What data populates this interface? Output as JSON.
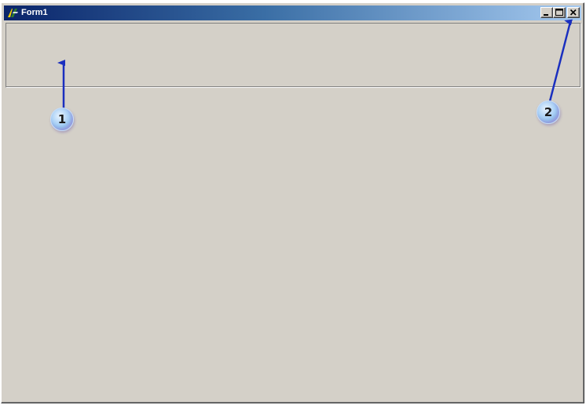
{
  "window": {
    "title": "Form1",
    "controls": {
      "minimize_icon": "minimize-icon",
      "maximize_icon": "maximize-icon",
      "close_icon": "close-icon"
    }
  },
  "annotations": [
    {
      "label": "1"
    },
    {
      "label": "2"
    }
  ],
  "colors": {
    "titlebar_start": "#0a246a",
    "titlebar_end": "#a6caf0",
    "face": "#d4d0c8",
    "annotation_arrow": "#1a2fbf"
  }
}
